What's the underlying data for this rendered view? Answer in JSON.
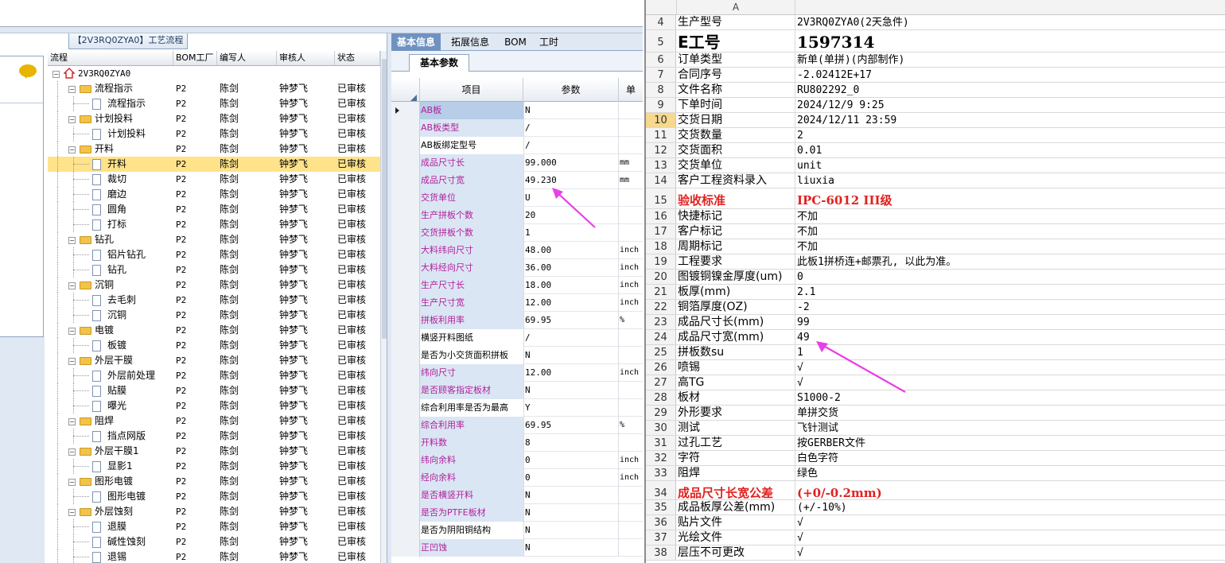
{
  "tree_panel": {
    "title": "【2V3RQ0ZYA0】工艺流程",
    "columns": [
      "流程",
      "BOM工厂",
      "编写人",
      "审核人",
      "状态"
    ],
    "rows": [
      {
        "depth": 0,
        "kind": "root",
        "label": "2V3RQ0ZYA0",
        "bom": "",
        "writer": "",
        "reviewer": "",
        "status": ""
      },
      {
        "depth": 1,
        "kind": "folder",
        "label": "流程指示",
        "bom": "P2",
        "writer": "陈剑",
        "reviewer": "钟梦飞",
        "status": "已审核"
      },
      {
        "depth": 2,
        "kind": "doc",
        "label": "流程指示",
        "bom": "P2",
        "writer": "陈剑",
        "reviewer": "钟梦飞",
        "status": "已审核"
      },
      {
        "depth": 1,
        "kind": "folder",
        "label": "计划投料",
        "bom": "P2",
        "writer": "陈剑",
        "reviewer": "钟梦飞",
        "status": "已审核"
      },
      {
        "depth": 2,
        "kind": "doc",
        "label": "计划投料",
        "bom": "P2",
        "writer": "陈剑",
        "reviewer": "钟梦飞",
        "status": "已审核"
      },
      {
        "depth": 1,
        "kind": "folder",
        "label": "开料",
        "bom": "P2",
        "writer": "陈剑",
        "reviewer": "钟梦飞",
        "status": "已审核"
      },
      {
        "depth": 2,
        "kind": "doc",
        "label": "开料",
        "bom": "P2",
        "writer": "陈剑",
        "reviewer": "钟梦飞",
        "status": "已审核",
        "selected": true
      },
      {
        "depth": 2,
        "kind": "doc",
        "label": "裁切",
        "bom": "P2",
        "writer": "陈剑",
        "reviewer": "钟梦飞",
        "status": "已审核"
      },
      {
        "depth": 2,
        "kind": "doc",
        "label": "磨边",
        "bom": "P2",
        "writer": "陈剑",
        "reviewer": "钟梦飞",
        "status": "已审核"
      },
      {
        "depth": 2,
        "kind": "doc",
        "label": "圆角",
        "bom": "P2",
        "writer": "陈剑",
        "reviewer": "钟梦飞",
        "status": "已审核"
      },
      {
        "depth": 2,
        "kind": "doc",
        "label": "打标",
        "bom": "P2",
        "writer": "陈剑",
        "reviewer": "钟梦飞",
        "status": "已审核"
      },
      {
        "depth": 1,
        "kind": "folder",
        "label": "钻孔",
        "bom": "P2",
        "writer": "陈剑",
        "reviewer": "钟梦飞",
        "status": "已审核"
      },
      {
        "depth": 2,
        "kind": "doc",
        "label": "铝片钻孔",
        "bom": "P2",
        "writer": "陈剑",
        "reviewer": "钟梦飞",
        "status": "已审核"
      },
      {
        "depth": 2,
        "kind": "doc",
        "label": "钻孔",
        "bom": "P2",
        "writer": "陈剑",
        "reviewer": "钟梦飞",
        "status": "已审核"
      },
      {
        "depth": 1,
        "kind": "folder",
        "label": "沉铜",
        "bom": "P2",
        "writer": "陈剑",
        "reviewer": "钟梦飞",
        "status": "已审核"
      },
      {
        "depth": 2,
        "kind": "doc",
        "label": "去毛刺",
        "bom": "P2",
        "writer": "陈剑",
        "reviewer": "钟梦飞",
        "status": "已审核"
      },
      {
        "depth": 2,
        "kind": "doc",
        "label": "沉铜",
        "bom": "P2",
        "writer": "陈剑",
        "reviewer": "钟梦飞",
        "status": "已审核"
      },
      {
        "depth": 1,
        "kind": "folder",
        "label": "电镀",
        "bom": "P2",
        "writer": "陈剑",
        "reviewer": "钟梦飞",
        "status": "已审核"
      },
      {
        "depth": 2,
        "kind": "doc",
        "label": "板镀",
        "bom": "P2",
        "writer": "陈剑",
        "reviewer": "钟梦飞",
        "status": "已审核"
      },
      {
        "depth": 1,
        "kind": "folder",
        "label": "外层干膜",
        "bom": "P2",
        "writer": "陈剑",
        "reviewer": "钟梦飞",
        "status": "已审核"
      },
      {
        "depth": 2,
        "kind": "doc",
        "label": "外层前处理",
        "bom": "P2",
        "writer": "陈剑",
        "reviewer": "钟梦飞",
        "status": "已审核"
      },
      {
        "depth": 2,
        "kind": "doc",
        "label": "贴膜",
        "bom": "P2",
        "writer": "陈剑",
        "reviewer": "钟梦飞",
        "status": "已审核"
      },
      {
        "depth": 2,
        "kind": "doc",
        "label": "曝光",
        "bom": "P2",
        "writer": "陈剑",
        "reviewer": "钟梦飞",
        "status": "已审核"
      },
      {
        "depth": 1,
        "kind": "folder",
        "label": "阻焊",
        "bom": "P2",
        "writer": "陈剑",
        "reviewer": "钟梦飞",
        "status": "已审核"
      },
      {
        "depth": 2,
        "kind": "doc",
        "label": "挡点网版",
        "bom": "P2",
        "writer": "陈剑",
        "reviewer": "钟梦飞",
        "status": "已审核"
      },
      {
        "depth": 1,
        "kind": "folder",
        "label": "外层干膜1",
        "bom": "P2",
        "writer": "陈剑",
        "reviewer": "钟梦飞",
        "status": "已审核"
      },
      {
        "depth": 2,
        "kind": "doc",
        "label": "显影1",
        "bom": "P2",
        "writer": "陈剑",
        "reviewer": "钟梦飞",
        "status": "已审核"
      },
      {
        "depth": 1,
        "kind": "folder",
        "label": "图形电镀",
        "bom": "P2",
        "writer": "陈剑",
        "reviewer": "钟梦飞",
        "status": "已审核"
      },
      {
        "depth": 2,
        "kind": "doc",
        "label": "图形电镀",
        "bom": "P2",
        "writer": "陈剑",
        "reviewer": "钟梦飞",
        "status": "已审核"
      },
      {
        "depth": 1,
        "kind": "folder",
        "label": "外层蚀刻",
        "bom": "P2",
        "writer": "陈剑",
        "reviewer": "钟梦飞",
        "status": "已审核"
      },
      {
        "depth": 2,
        "kind": "doc",
        "label": "退膜",
        "bom": "P2",
        "writer": "陈剑",
        "reviewer": "钟梦飞",
        "status": "已审核"
      },
      {
        "depth": 2,
        "kind": "doc",
        "label": "碱性蚀刻",
        "bom": "P2",
        "writer": "陈剑",
        "reviewer": "钟梦飞",
        "status": "已审核"
      },
      {
        "depth": 2,
        "kind": "doc",
        "label": "退锡",
        "bom": "P2",
        "writer": "陈剑",
        "reviewer": "钟梦飞",
        "status": "已审核"
      }
    ]
  },
  "mid_panel": {
    "tabs": [
      "基本信息",
      "拓展信息",
      "BOM",
      "工时"
    ],
    "active_tab": 0,
    "subtab": "基本参数",
    "headers": {
      "item": "项目",
      "param": "参数",
      "unit": "单"
    },
    "rows": [
      {
        "name": "AB板",
        "value": "N",
        "unit": "",
        "hl": true
      },
      {
        "name": "AB板类型",
        "value": "/",
        "unit": "",
        "hl": true
      },
      {
        "name": "AB板绑定型号",
        "value": "/",
        "unit": "",
        "hl": false
      },
      {
        "name": "成品尺寸长",
        "value": "99.000",
        "unit": "mm",
        "hl": true
      },
      {
        "name": "成品尺寸宽",
        "value": "49.230",
        "unit": "mm",
        "hl": true
      },
      {
        "name": "交货单位",
        "value": "U",
        "unit": "",
        "hl": true
      },
      {
        "name": "生产拼板个数",
        "value": "20",
        "unit": "",
        "hl": true
      },
      {
        "name": "交货拼板个数",
        "value": "1",
        "unit": "",
        "hl": true
      },
      {
        "name": "大料纬向尺寸",
        "value": "48.00",
        "unit": "inch",
        "hl": true
      },
      {
        "name": "大料经向尺寸",
        "value": "36.00",
        "unit": "inch",
        "hl": true
      },
      {
        "name": "生产尺寸长",
        "value": "18.00",
        "unit": "inch",
        "hl": true
      },
      {
        "name": "生产尺寸宽",
        "value": "12.00",
        "unit": "inch",
        "hl": true
      },
      {
        "name": "拼板利用率",
        "value": "69.95",
        "unit": "%",
        "hl": true
      },
      {
        "name": "横竖开料图纸",
        "value": "/",
        "unit": "",
        "hl": false
      },
      {
        "name": "是否为小交货面积拼板",
        "value": "N",
        "unit": "",
        "hl": false
      },
      {
        "name": "纬向尺寸",
        "value": "12.00",
        "unit": "inch",
        "hl": true
      },
      {
        "name": "是否顾客指定板材",
        "value": "N",
        "unit": "",
        "hl": true
      },
      {
        "name": "综合利用率是否为最高",
        "value": "Y",
        "unit": "",
        "hl": false
      },
      {
        "name": "综合利用率",
        "value": "69.95",
        "unit": "%",
        "hl": true
      },
      {
        "name": "开料数",
        "value": "8",
        "unit": "",
        "hl": true
      },
      {
        "name": "纬向余料",
        "value": "0",
        "unit": "inch",
        "hl": true
      },
      {
        "name": "经向余料",
        "value": "0",
        "unit": "inch",
        "hl": true
      },
      {
        "name": "是否横竖开料",
        "value": "N",
        "unit": "",
        "hl": true
      },
      {
        "name": "是否为PTFE板材",
        "value": "N",
        "unit": "",
        "hl": true
      },
      {
        "name": "是否为阴阳铜结构",
        "value": "N",
        "unit": "",
        "hl": false
      },
      {
        "name": "正凹蚀",
        "value": "N",
        "unit": "",
        "hl": true
      }
    ]
  },
  "sheet": {
    "column_a": "A",
    "selected_row": "10",
    "rows": [
      {
        "num": "4",
        "a": "生产型号",
        "b": "2V3RQ0ZYA0(2天急件)",
        "style": ""
      },
      {
        "num": "5",
        "a": "E工号",
        "b": "1597314",
        "style": "big"
      },
      {
        "num": "6",
        "a": "订单类型",
        "b": "新单(单拼)(内部制作)",
        "style": ""
      },
      {
        "num": "7",
        "a": "合同序号",
        "b": "-2.02412E+17",
        "style": ""
      },
      {
        "num": "8",
        "a": "文件名称",
        "b": "RU802292_0",
        "style": ""
      },
      {
        "num": "9",
        "a": "下单时间",
        "b": "2024/12/9 9:25",
        "style": ""
      },
      {
        "num": "10",
        "a": "交货日期",
        "b": "2024/12/11 23:59",
        "style": ""
      },
      {
        "num": "11",
        "a": "交货数量",
        "b": "2",
        "style": ""
      },
      {
        "num": "12",
        "a": "交货面积",
        "b": "0.01",
        "style": ""
      },
      {
        "num": "13",
        "a": "交货单位",
        "b": "unit",
        "style": ""
      },
      {
        "num": "14",
        "a": "客户工程资料录入",
        "b": "liuxia",
        "style": ""
      },
      {
        "num": "15",
        "a": "验收标准",
        "b": "IPC-6012 III级",
        "style": "red"
      },
      {
        "num": "16",
        "a": "快捷标记",
        "b": "不加",
        "style": ""
      },
      {
        "num": "17",
        "a": "客户标记",
        "b": "不加",
        "style": ""
      },
      {
        "num": "18",
        "a": "周期标记",
        "b": "不加",
        "style": ""
      },
      {
        "num": "19",
        "a": "工程要求",
        "b": "此板1拼桥连+邮票孔, 以此为准。",
        "style": ""
      },
      {
        "num": "20",
        "a": "图镀铜镍金厚度(um)",
        "b": "0",
        "style": ""
      },
      {
        "num": "21",
        "a": "板厚(mm)",
        "b": "2.1",
        "style": ""
      },
      {
        "num": "22",
        "a": "铜箔厚度(OZ)",
        "b": "-2",
        "style": ""
      },
      {
        "num": "23",
        "a": "成品尺寸长(mm)",
        "b": "99",
        "style": ""
      },
      {
        "num": "24",
        "a": "成品尺寸宽(mm)",
        "b": "49",
        "style": ""
      },
      {
        "num": "25",
        "a": "拼板数su",
        "b": "1",
        "style": ""
      },
      {
        "num": "26",
        "a": "喷锡",
        "b": "√",
        "style": ""
      },
      {
        "num": "27",
        "a": "高TG",
        "b": "√",
        "style": ""
      },
      {
        "num": "28",
        "a": "板材",
        "b": "S1000-2",
        "style": ""
      },
      {
        "num": "29",
        "a": "外形要求",
        "b": "单拼交货",
        "style": ""
      },
      {
        "num": "30",
        "a": "测试",
        "b": "飞针测试",
        "style": ""
      },
      {
        "num": "31",
        "a": "过孔工艺",
        "b": "按GERBER文件",
        "style": ""
      },
      {
        "num": "32",
        "a": "字符",
        "b": "白色字符",
        "style": ""
      },
      {
        "num": "33",
        "a": "阻焊",
        "b": "绿色",
        "style": ""
      },
      {
        "num": "34",
        "a": "成品尺寸长宽公差",
        "b": "(+0/-0.2mm)",
        "style": "red"
      },
      {
        "num": "35",
        "a": "成品板厚公差(mm)",
        "b": "(+/-10%)",
        "style": ""
      },
      {
        "num": "36",
        "a": "贴片文件",
        "b": "√",
        "style": ""
      },
      {
        "num": "37",
        "a": "光绘文件",
        "b": "√",
        "style": ""
      },
      {
        "num": "38",
        "a": "层压不可更改",
        "b": "√",
        "style": ""
      }
    ]
  },
  "colors": {
    "magenta_text": "#b1209a",
    "red_text": "#e0221f",
    "selected_row": "#ffe38a",
    "arrow": "#e93fe6",
    "tab_active": "#6f93c0"
  }
}
